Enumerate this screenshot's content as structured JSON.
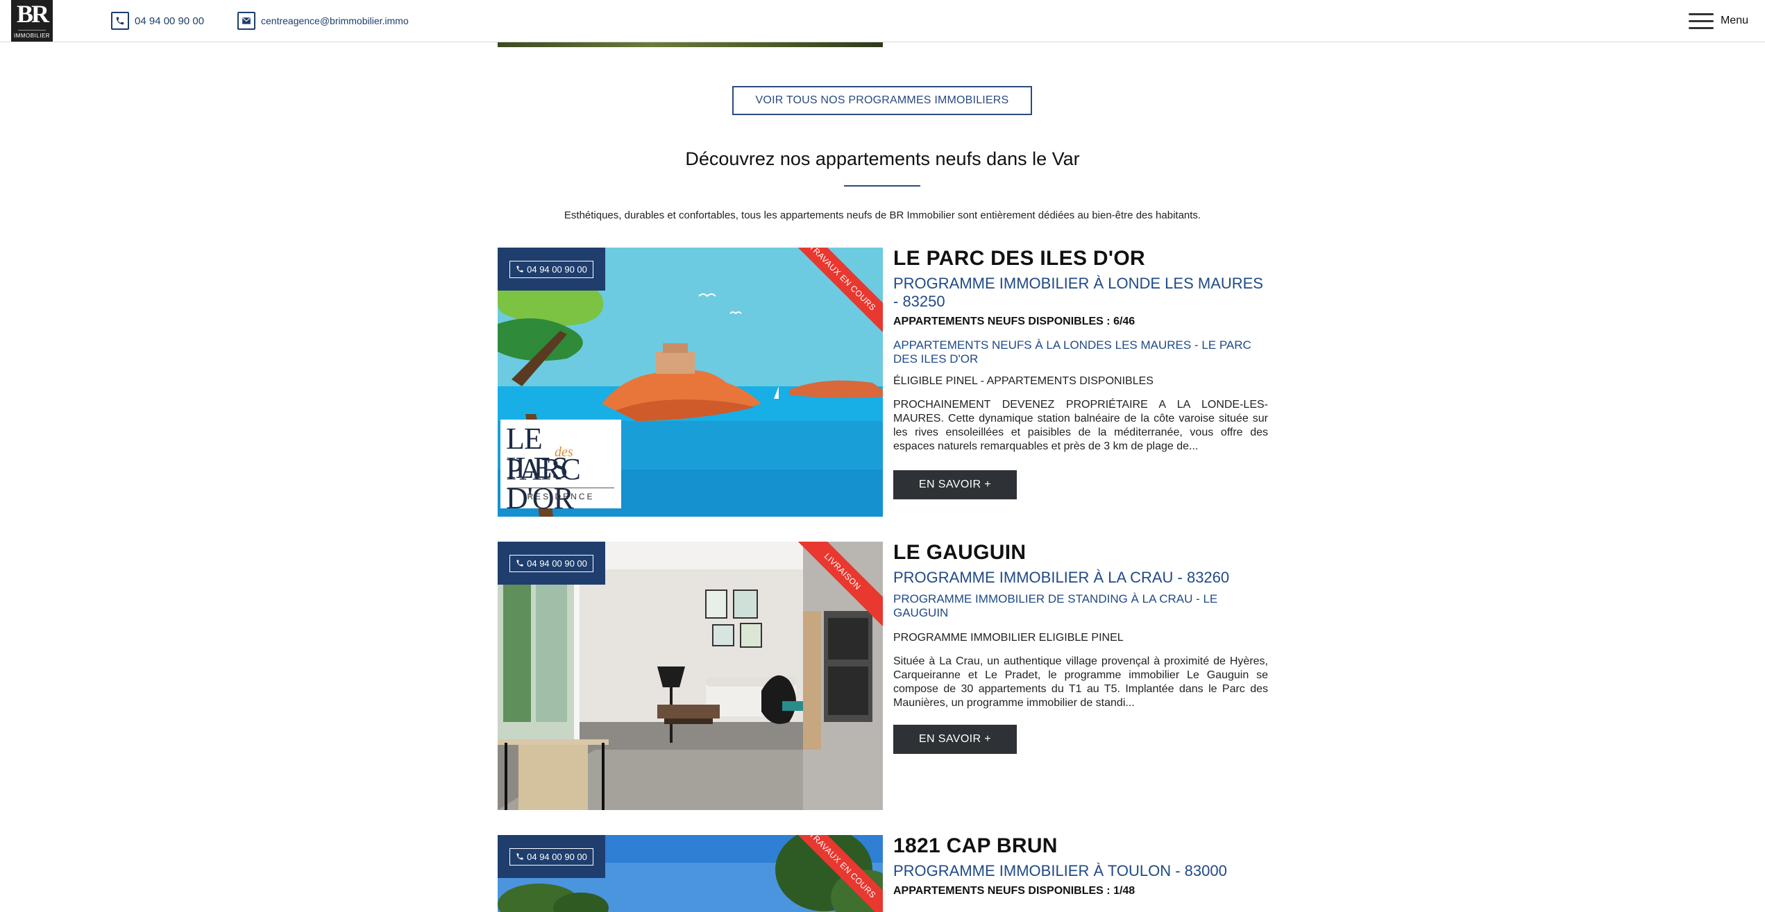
{
  "header": {
    "logo_text": "BR",
    "logo_sub": "IMMOBILIER",
    "phone": "04 94 00 90 00",
    "email": "centreagence@brimmobilier.immo",
    "menu_label": "Menu"
  },
  "cta_all_programs": "VOIR TOUS NOS PROGRAMMES IMMOBILIERS",
  "section": {
    "title": "Découvrez nos appartements neufs dans le Var",
    "intro": "Esthétiques, durables et confortables, tous les appartements neufs de BR Immobilier sont entièrement dédiées au bien-être des habitants."
  },
  "programs": [
    {
      "phone": "04 94 00 90 00",
      "ribbon": "TRAVAUX EN COURS",
      "logo_line1": "LE PARC",
      "logo_script": "des",
      "logo_line2": "ILES D'OR",
      "logo_line3": "RESIDENCE",
      "title": "LE PARC DES ILES D'OR",
      "subtitle": "PROGRAMME IMMOBILIER À LONDE LES MAURES - 83250",
      "availability": "APPARTEMENTS NEUFS DISPONIBLES : 6/46",
      "heading": "APPARTEMENTS NEUFS À LA LONDES LES MAURES - LE PARC DES ILES D'OR",
      "line": "ÉLIGIBLE PINEL - APPARTEMENTS DISPONIBLES",
      "description": "PROCHAINEMENT DEVENEZ PROPRIÉTAIRE A LA LONDE-LES-MAURES. Cette dynamique station balnéaire de la côte varoise située sur les rives ensoleillées et paisibles de la méditerranée, vous offre des espaces naturels remarquables et près de 3 km de plage de...",
      "button": "EN SAVOIR +"
    },
    {
      "phone": "04 94 00 90 00",
      "ribbon": "LIVRAISON",
      "title": "LE GAUGUIN",
      "subtitle": "PROGRAMME IMMOBILIER À LA CRAU - 83260",
      "heading": "PROGRAMME IMMOBILIER DE STANDING À LA CRAU - LE GAUGUIN",
      "line": "PROGRAMME IMMOBILIER ELIGIBLE PINEL",
      "description": "Située à La Crau, un authentique village provençal à proximité de Hyères, Carqueiranne et Le Pradet, le programme immobilier Le Gauguin se compose de 30 appartements du T1 au T5. Implantée dans le Parc des Maunières, un programme immobilier de standi...",
      "button": "EN SAVOIR +"
    },
    {
      "phone": "04 94 00 90 00",
      "ribbon": "TRAVAUX EN COURS",
      "title": "1821 CAP BRUN",
      "subtitle": "PROGRAMME IMMOBILIER À TOULON - 83000",
      "availability": "APPARTEMENTS NEUFS DISPONIBLES : 1/48"
    }
  ],
  "colors": {
    "brand_navy": "#1f3e6d",
    "link_blue": "#1f4a86",
    "ribbon_red": "#e8382f",
    "button_dark": "#2e3135"
  }
}
